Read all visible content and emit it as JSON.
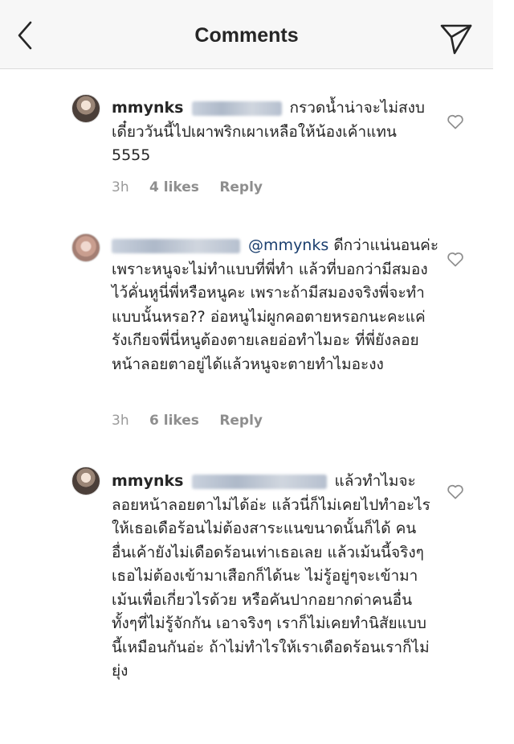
{
  "header": {
    "title": "Comments",
    "back_icon": "chevron-left-icon",
    "send_icon": "paper-plane-icon"
  },
  "comments": [
    {
      "username": "mmynks",
      "body": "กรวดน้ำน่าจะไม่สงบ เดี๋ยววันนี้ไปเผาพริกเผาเหลือให้น้องเค้าแทน 5555",
      "time": "3h",
      "likes": "4 likes",
      "reply": "Reply"
    },
    {
      "mention": "@mmynks",
      "body": "ดีกว่าแน่นอนค่ะเพราะหนูจะไม่ทำแบบที่พี่ทำ แล้วที่บอกว่ามีสมองไว้คั่นหูนี่พี่หรือหนูคะ เพราะถ้ามีสมองจริงพี่จะทำแบบนั้นหรอ?? อ่อหนูไม่ผูกคอตายหรอกนะคะแค่รังเกียจพี่นี่หนูต้องตายเลยอ่อทำไมอะ ที่พี่ยังลอยหน้าลอยตาอยู่ได้แล้วหนูจะตายทำไมอะงง",
      "time": "3h",
      "likes": "6 likes",
      "reply": "Reply"
    },
    {
      "username": "mmynks",
      "body": "แล้วทำไมจะลอยหน้าลอยตาไม่ได้อ่ะ แล้วนี่ก็ไม่เคยไปทำอะไรให้เธอเดือร้อนไม่ต้องสาระแนขนาดนั้นก็ได้ คนอื่นเค้ายังไม่เดือดร้อนเท่าเธอเลย แล้วเม้นนี้จริงๆเธอไม่ต้องเข้ามาเสือกก็ได้นะ ไม่รู้อยู่ๆจะเข้ามาเม้นเพื่อเกี่ยวไรด้วย หรือคันปากอยากด่าคนอื่นทั้งๆที่ไม่รู้จักกัน เอาจริงๆ เราก็ไม่เคยทำนิสัยแบบนี้เหมือนกันอ่ะ ถ้าไม่ทำไรให้เราเดือดร้อนเราก็ไม่ยุ่ง"
    }
  ]
}
